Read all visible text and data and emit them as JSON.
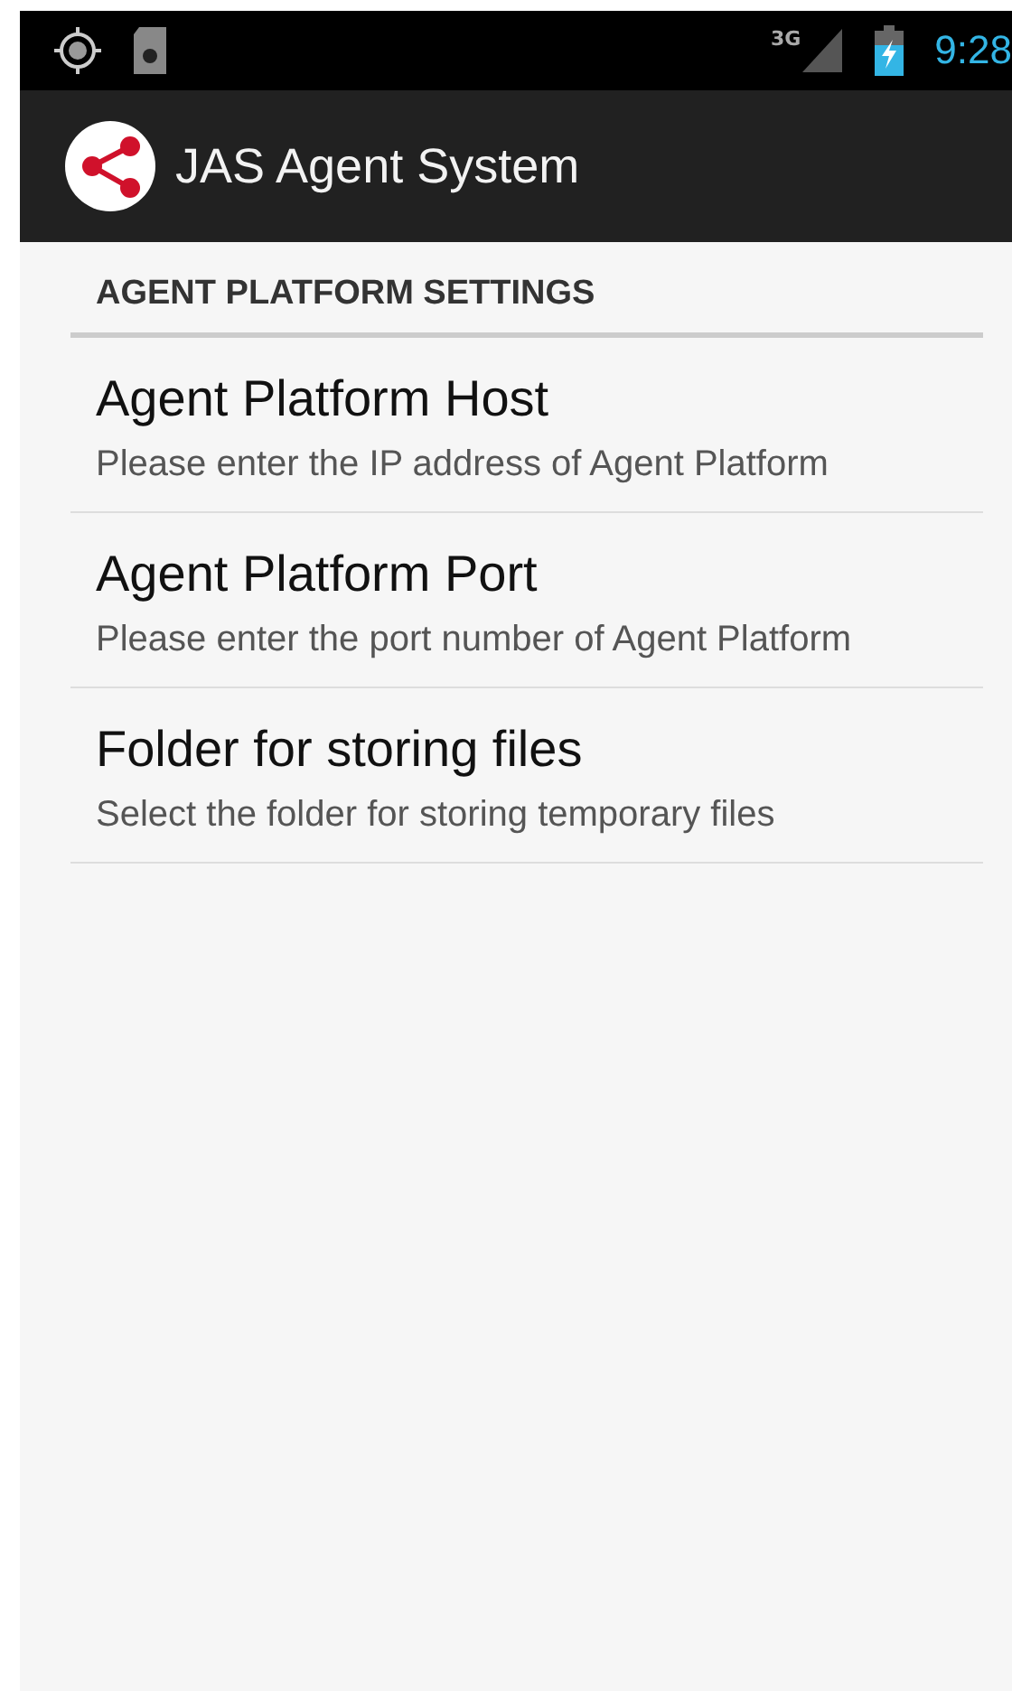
{
  "status_bar": {
    "network": "3G",
    "time": "9:28"
  },
  "action_bar": {
    "title": "JAS Agent System"
  },
  "category": {
    "title": "AGENT PLATFORM SETTINGS"
  },
  "preferences": [
    {
      "title": "Agent Platform Host",
      "summary": "Please enter the IP address of Agent Platform"
    },
    {
      "title": "Agent Platform Port",
      "summary": "Please enter the port number of Agent Platform"
    },
    {
      "title": "Folder for storing files",
      "summary": "Select the folder for storing temporary files"
    }
  ]
}
